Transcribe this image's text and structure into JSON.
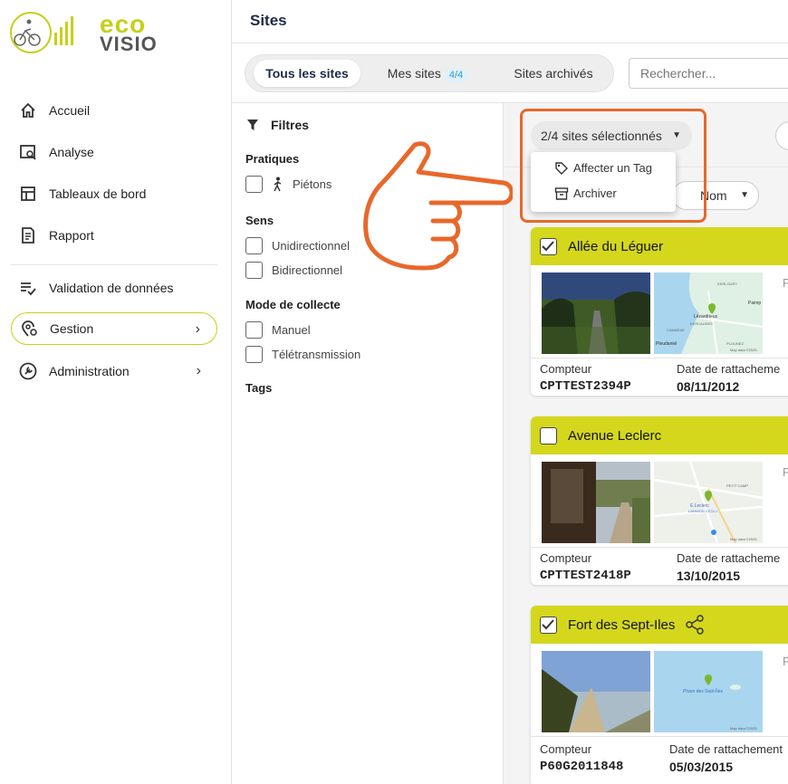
{
  "logo": {
    "line1": "eco",
    "line2": "VISIO"
  },
  "sidebar": {
    "items": [
      {
        "label": "Accueil",
        "icon": "home-icon"
      },
      {
        "label": "Analyse",
        "icon": "analysis-icon"
      },
      {
        "label": "Tableaux de bord",
        "icon": "dashboard-icon"
      },
      {
        "label": "Rapport",
        "icon": "report-icon"
      },
      {
        "label": "Validation de données",
        "icon": "validation-icon"
      },
      {
        "label": "Gestion",
        "icon": "location-gear-icon"
      },
      {
        "label": "Administration",
        "icon": "wrench-icon"
      }
    ]
  },
  "header": {
    "title": "Sites"
  },
  "tabs": [
    {
      "label": "Tous les sites"
    },
    {
      "label": "Mes sites",
      "badge": "4/4"
    },
    {
      "label": "Sites archivés"
    }
  ],
  "search": {
    "placeholder": "Rechercher..."
  },
  "filters": {
    "title": "Filtres",
    "sections": [
      {
        "title": "Pratiques",
        "options": [
          "Piétons"
        ]
      },
      {
        "title": "Sens",
        "options": [
          "Unidirectionnel",
          "Bidirectionnel"
        ]
      },
      {
        "title": "Mode de collecte",
        "options": [
          "Manuel",
          "Télétransmission"
        ]
      },
      {
        "title": "Tags",
        "options": []
      }
    ]
  },
  "selection": {
    "label": "2/4 sites sélectionnés",
    "menu": [
      "Affecter un Tag",
      "Archiver"
    ]
  },
  "sort": {
    "label": "Nom"
  },
  "cards": [
    {
      "name": "Allée du Léguer",
      "checked": true,
      "counter_label": "Compteur",
      "counter": "CPTTEST2394P",
      "date_label": "Date de rattacheme",
      "date": "08/11/2012",
      "map_labels": [
        "Lézardrieux",
        "Paimp",
        "KERLOURY",
        "CAMARAE",
        "KERCAUDES",
        "Pleudaniel",
        "PLOUNEZ",
        "Map data ©2025"
      ]
    },
    {
      "name": "Avenue Leclerc",
      "checked": false,
      "counter_label": "Compteur",
      "counter": "CPTTEST2418P",
      "date_label": "Date de rattacheme",
      "date": "13/10/2015",
      "map_labels": [
        "E.Leclerc",
        "LANNION CEDEX",
        "PETIT CAMP",
        "Map data ©2025"
      ]
    },
    {
      "name": "Fort des Sept-Iles",
      "checked": true,
      "counter_label": "Compteur",
      "counter": "P60G2011848",
      "date_label": "Date de rattachement",
      "date": "05/03/2015",
      "map_labels": [
        "Phare des Sept-Îles",
        "Map data ©2025"
      ]
    }
  ],
  "colors": {
    "accent": "#d4d71c",
    "highlight": "#e8682a",
    "title": "#1e2a44"
  }
}
